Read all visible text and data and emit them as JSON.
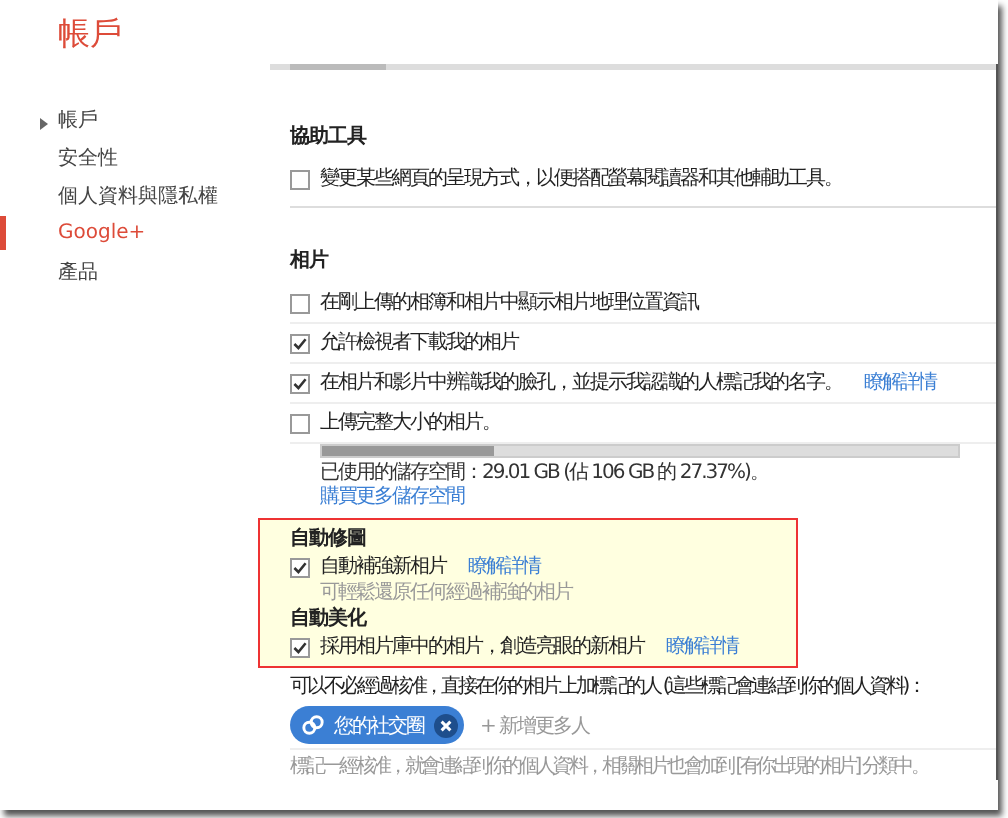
{
  "title": "帳戶",
  "sidebar": [
    {
      "label": "帳戶",
      "selected": false,
      "arrow": true
    },
    {
      "label": "安全性",
      "selected": false,
      "arrow": false
    },
    {
      "label": "個人資料與隱私權",
      "selected": false,
      "arrow": false
    },
    {
      "label": "Google+",
      "selected": true,
      "arrow": false
    },
    {
      "label": "產品",
      "selected": false,
      "arrow": false
    }
  ],
  "sections": [
    {
      "heading": "協助工具",
      "items": [
        {
          "label": "變更某些網頁的呈現方式，以便搭配螢幕閱讀器和其他輔助工具。",
          "checked": false
        }
      ]
    },
    {
      "heading": "相片",
      "items": [
        {
          "label": "在剛上傳的相簿和相片中顯示相片地理位置資訊",
          "checked": false
        },
        {
          "label": "允許檢視者下載我的相片",
          "checked": true
        },
        {
          "label": "在相片和影片中辨識我的臉孔，並提示我認識的人標記我的名字。",
          "checked": true,
          "link": "瞭解詳情"
        },
        {
          "label": "上傳完整大小的相片。",
          "checked": false,
          "storage": {
            "level": 0.27,
            "usage": "已使用的儲存空間：29.01 GB (佔 106 GB 的 27.37%)。",
            "link": "購買更多儲存空間"
          }
        }
      ]
    }
  ],
  "highlight": [
    {
      "heading": "自動修圖",
      "label": "自動補強新相片",
      "checked": true,
      "link": "瞭解詳情",
      "hint": "可輕鬆還原任何經過補強的相片"
    },
    {
      "heading": "自動美化",
      "label": "採用相片庫中的相片，創造亮眼的新相片",
      "checked": true,
      "link": "瞭解詳情"
    }
  ],
  "tagging": {
    "text": "可以不必經過核准，直接在你的相片上加標記的人 (這些標記會連結到你的個人資料)：",
    "chip": "您的社交圈",
    "add_more": "+ 新增更多人",
    "footer": "標記一經核准，就會連結到你的個人資料，相關相片也會加到 [有你出現的相片] 分類中。"
  }
}
